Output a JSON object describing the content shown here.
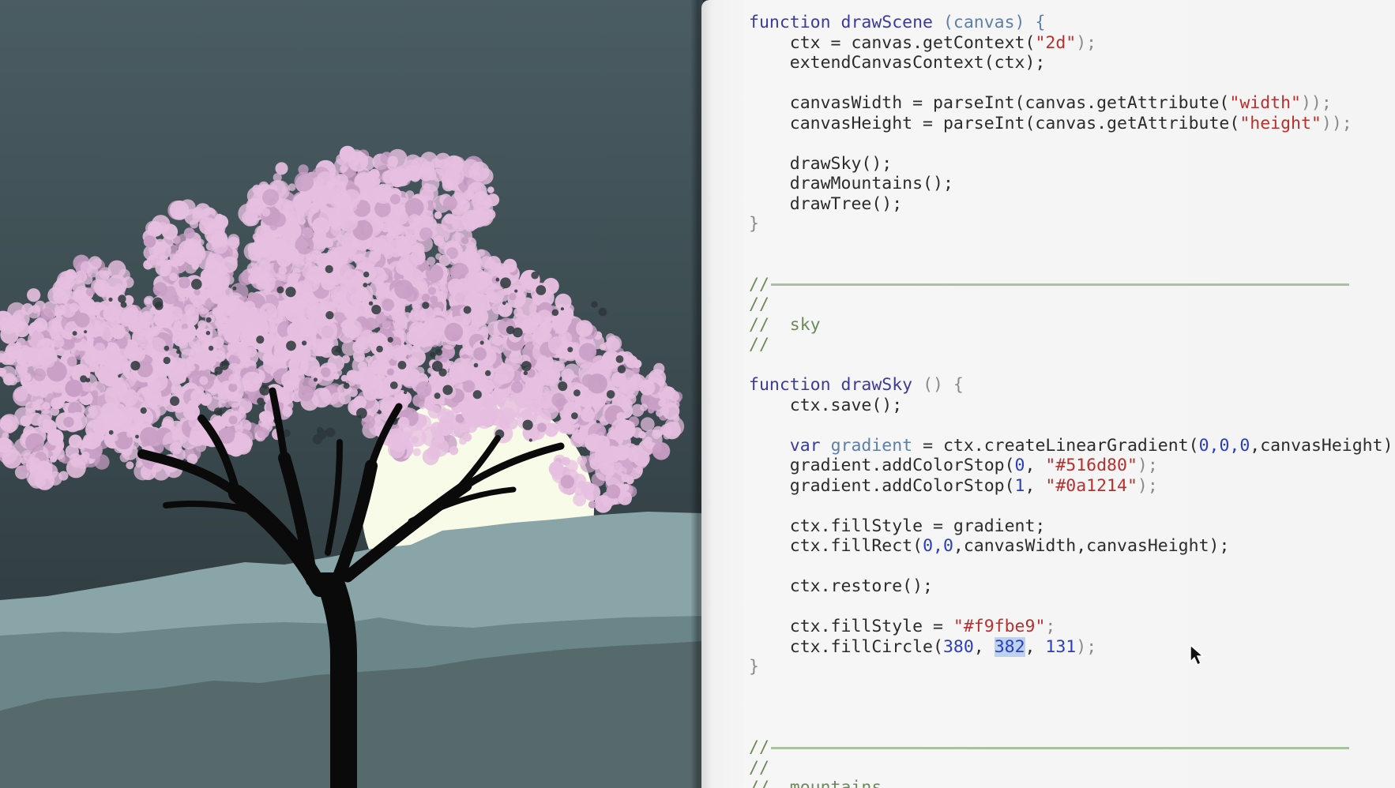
{
  "canvas": {
    "colors": {
      "sky": "#3a4b50",
      "moon": "#f9fbe9",
      "far_mountain": "#8aa5a8",
      "near_mountain": "#6b8688",
      "front_hill": "#56696b",
      "trunk": "#0a0a0a",
      "blossom": "#e6bfe0",
      "blossom_dark": "#c99fc6"
    },
    "moon_icon": "moon",
    "tree_icon": "cherry-blossom-tree"
  },
  "editor": {
    "code_lines": [
      [
        [
          "function drawScene ",
          "kw"
        ],
        [
          "(canvas) {",
          "prm"
        ]
      ],
      [
        [
          "    ctx = canvas.getContext(",
          ""
        ],
        [
          "\"2d\"",
          "str"
        ],
        [
          ");",
          "pun"
        ]
      ],
      [
        [
          "    extendCanvasContext(ctx);",
          ""
        ]
      ],
      [
        [
          "",
          ""
        ]
      ],
      [
        [
          "    canvasWidth = parseInt(canvas.getAttribute(",
          ""
        ],
        [
          "\"width\"",
          "str"
        ],
        [
          "));",
          "pun"
        ]
      ],
      [
        [
          "    canvasHeight = parseInt(canvas.getAttribute(",
          ""
        ],
        [
          "\"height\"",
          "str"
        ],
        [
          "));",
          "pun"
        ]
      ],
      [
        [
          "",
          ""
        ]
      ],
      [
        [
          "    drawSky();",
          ""
        ]
      ],
      [
        [
          "    drawMountains();",
          ""
        ]
      ],
      [
        [
          "    drawTree();",
          ""
        ]
      ],
      [
        [
          "}",
          "pun"
        ]
      ],
      [
        [
          "",
          ""
        ]
      ],
      [
        [
          "",
          ""
        ]
      ],
      [
        [
          "//",
          "cmt"
        ],
        [
          "__RULE__",
          "rule"
        ]
      ],
      [
        [
          "//",
          "cmt"
        ]
      ],
      [
        [
          "//  sky",
          "cmt"
        ]
      ],
      [
        [
          "//",
          "cmt"
        ]
      ],
      [
        [
          "",
          ""
        ]
      ],
      [
        [
          "function drawSky ",
          "kw"
        ],
        [
          "() {",
          "pun"
        ]
      ],
      [
        [
          "    ctx.save();",
          ""
        ]
      ],
      [
        [
          "",
          ""
        ]
      ],
      [
        [
          "    var ",
          "kw"
        ],
        [
          "gradient",
          "var"
        ],
        [
          " = ctx.createLinearGradient(",
          ""
        ],
        [
          "0,0,0",
          "num"
        ],
        [
          ",canvasHeight);",
          ""
        ]
      ],
      [
        [
          "    gradient.addColorStop(",
          ""
        ],
        [
          "0",
          "num"
        ],
        [
          ", ",
          ""
        ],
        [
          "\"#516d80\"",
          "str"
        ],
        [
          ");",
          "pun"
        ]
      ],
      [
        [
          "    gradient.addColorStop(",
          ""
        ],
        [
          "1",
          "num"
        ],
        [
          ", ",
          ""
        ],
        [
          "\"#0a1214\"",
          "str"
        ],
        [
          ");",
          "pun"
        ]
      ],
      [
        [
          "",
          ""
        ]
      ],
      [
        [
          "    ctx.fillStyle = gradient;",
          ""
        ]
      ],
      [
        [
          "    ctx.fillRect(",
          ""
        ],
        [
          "0,0",
          "num"
        ],
        [
          ",canvasWidth,canvasHeight);",
          ""
        ]
      ],
      [
        [
          "",
          ""
        ]
      ],
      [
        [
          "    ctx.restore();",
          ""
        ]
      ],
      [
        [
          "",
          ""
        ]
      ],
      [
        [
          "    ctx.fillStyle = ",
          ""
        ],
        [
          "\"#f9fbe9\"",
          "str"
        ],
        [
          ";",
          "pun"
        ]
      ],
      [
        [
          "    ctx.fillCircle(",
          ""
        ],
        [
          "380",
          "num"
        ],
        [
          ", ",
          ""
        ],
        [
          "382",
          "sel"
        ],
        [
          ", ",
          ""
        ],
        [
          "131",
          "num"
        ],
        [
          ");",
          "pun"
        ]
      ],
      [
        [
          "}",
          "pun"
        ]
      ],
      [
        [
          "",
          ""
        ]
      ],
      [
        [
          "",
          ""
        ]
      ],
      [
        [
          "",
          ""
        ]
      ],
      [
        [
          "//",
          "cmt"
        ],
        [
          "__RULE__",
          "rule"
        ]
      ],
      [
        [
          "//",
          "cmt"
        ]
      ],
      [
        [
          "//  mountains",
          "cmt"
        ]
      ]
    ],
    "cursor_icon": "mouse-pointer-icon"
  }
}
